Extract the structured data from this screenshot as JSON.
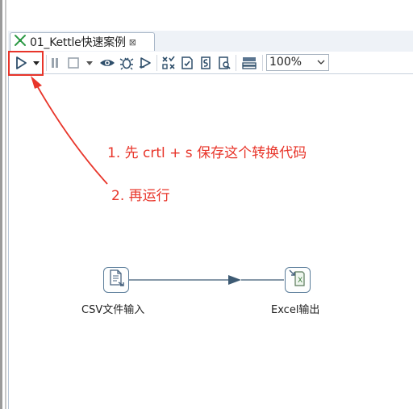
{
  "tab": {
    "title": "01_Kettle快速案例",
    "close_glyph": "⊠",
    "icon": "transformation-icon"
  },
  "toolbar": {
    "buttons": [
      {
        "name": "run",
        "icon": "run-icon"
      },
      {
        "name": "run-options",
        "icon": "chevron-down-icon"
      },
      {
        "name": "pause",
        "icon": "pause-icon"
      },
      {
        "name": "stop",
        "icon": "stop-icon"
      },
      {
        "name": "stop-options",
        "icon": "chevron-down-icon"
      },
      {
        "name": "preview",
        "icon": "preview-icon"
      },
      {
        "name": "debug",
        "icon": "debug-icon"
      },
      {
        "name": "replay",
        "icon": "replay-icon"
      },
      {
        "name": "verify",
        "icon": "verify-icon"
      },
      {
        "name": "impact",
        "icon": "impact-icon"
      },
      {
        "name": "sql",
        "icon": "sql-icon"
      },
      {
        "name": "explore-db",
        "icon": "explore-db-icon"
      },
      {
        "name": "show-results",
        "icon": "results-icon"
      }
    ],
    "zoom": {
      "value": "100%"
    }
  },
  "annotations": {
    "step1": "1. 先 crtl + s 保存这个转换代码",
    "step2": "2. 再运行"
  },
  "steps": {
    "csv_input": {
      "label": "CSV文件输入",
      "icon": "csv-file-input-icon"
    },
    "excel_output": {
      "label": "Excel输出",
      "icon": "excel-output-icon"
    }
  },
  "colors": {
    "annotation_red": "#e8352a",
    "hop_line": "#3d5a73",
    "toolbar_icon": "#2f4f6b"
  }
}
